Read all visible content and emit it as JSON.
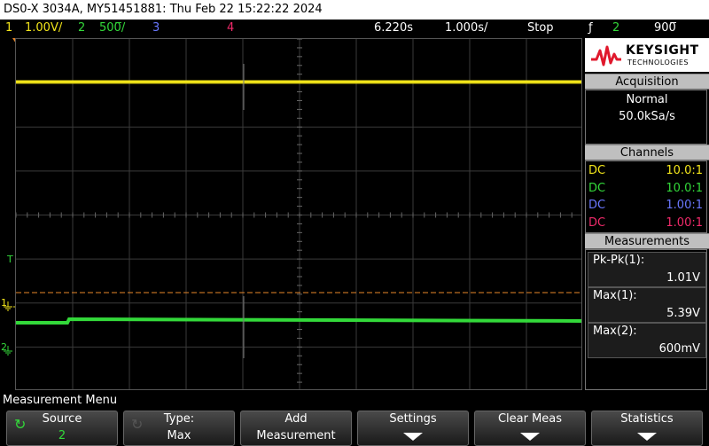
{
  "title": "DS0-X 3034A, MY51451881: Thu Feb 22 15:22:22 2024",
  "status": {
    "ch1_num": "1",
    "ch1_scale": "1.00V/",
    "ch2_num": "2",
    "ch2_scale": "500̅/",
    "ch3_num": "3",
    "ch4_num": "4",
    "time_offset": "6.220s",
    "time_scale": "1.000s/",
    "run_state": "Stop",
    "trigger_symbol": "ƒ",
    "trigger_source": "2",
    "trigger_level": "900̅"
  },
  "markers": {
    "ch1": "1",
    "ch2": "2",
    "trigger": "T"
  },
  "logo": {
    "brand": "KEYSIGHT",
    "sub": "TECHNOLOGIES"
  },
  "acquisition": {
    "header": "Acquisition",
    "mode": "Normal",
    "rate": "50.0kSa/s"
  },
  "channels": {
    "header": "Channels",
    "rows": [
      {
        "coupling": "DC",
        "probe": "10.0:1",
        "color": "#f2e51a"
      },
      {
        "coupling": "DC",
        "probe": "10.0:1",
        "color": "#33d93a"
      },
      {
        "coupling": "DC",
        "probe": "1.00:1",
        "color": "#6a78ff"
      },
      {
        "coupling": "DC",
        "probe": "1.00:1",
        "color": "#f02a6a"
      }
    ]
  },
  "measurements": {
    "header": "Measurements",
    "items": [
      {
        "label": "Pk-Pk(1):",
        "value": "1.01V"
      },
      {
        "label": "Max(1):",
        "value": "5.39V"
      },
      {
        "label": "Max(2):",
        "value": "600mV"
      }
    ]
  },
  "menu": {
    "title": "Measurement Menu",
    "keys": [
      {
        "line1": "Source",
        "line2": "2"
      },
      {
        "line1": "Type:",
        "line2": "Max"
      },
      {
        "line1": "Add",
        "line2": "Measurement"
      },
      {
        "line1": "Settings",
        "line2": ""
      },
      {
        "line1": "Clear Meas",
        "line2": ""
      },
      {
        "line1": "Statistics",
        "line2": ""
      }
    ]
  },
  "colors": {
    "ch1": "#f2e51a",
    "ch2": "#33d93a",
    "ch3": "#6a78ff",
    "ch4": "#f02a6a",
    "trigger_line": "#e8872a",
    "accent_red": "#e0182c"
  }
}
